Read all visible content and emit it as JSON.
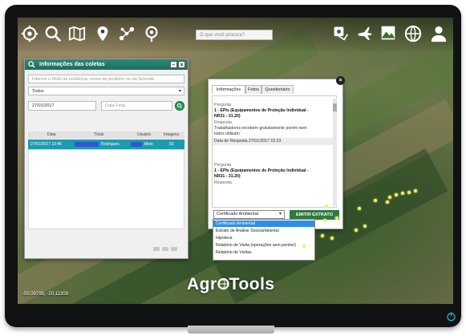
{
  "toolbar": {
    "search_placeholder": "O que você procura?",
    "left_icons": [
      "gear-globe-icon",
      "magnifier-icon",
      "map-icon",
      "map-pin-icon",
      "network-icon",
      "location-target-icon"
    ],
    "right_icons": [
      "gps-route-icon",
      "airplane-icon",
      "landscape-icon",
      "globe-icon",
      "user-icon"
    ]
  },
  "coletas_panel": {
    "title": "Informações das coletas",
    "search_placeholder": "Informe o título da evidência, nome do produtor ou da fazenda",
    "filter_value": "Todos",
    "date_start": "27/01/2017",
    "date_end_placeholder": "Data Final",
    "columns": [
      "Data",
      "Título",
      "Usuário",
      "Imagens"
    ],
    "rows": [
      {
        "data": "27/01/2017 15:46",
        "titulo": "Rodrigues",
        "usuario": "Melo",
        "imagens": "60"
      }
    ]
  },
  "details_panel": {
    "tabs": [
      "Informações",
      "Fotos",
      "Questionário"
    ],
    "active_tab": "Informações",
    "entries": [
      {
        "pergunta_label": "Pergunta",
        "pergunta_lines": [
          "1 - EPIs (Equipamentos de Proteção Individual -",
          "NR31 - 31.20)"
        ],
        "resposta_label": "Resposta",
        "resposta_lines": [
          "Trabalhadores recebem gratuitamente porém nem",
          "todos utilizam"
        ],
        "data_resposta": "Data de Resposta 27/01/2017 15:23"
      },
      {
        "pergunta_label": "Pergunta",
        "pergunta_lines": [
          "1 - EPIs (Equipamentos de Proteção Individual -",
          "NR31 - 31.20)"
        ],
        "resposta_label": "Resposta"
      }
    ],
    "select_value": "Certificado Ambiental",
    "emitir_label": "EMITIR EXTRATO",
    "options": [
      "Certificado Ambiental",
      "Extrato de Análise Socioambiental",
      "Hipoteca",
      "Relatório de Visita (operações sem penhor)",
      "Relatório de Visitas"
    ]
  },
  "logo_text": {
    "part1": "Agr",
    "part2": "Tools"
  },
  "coordinates": "-50.39798, -20.11308",
  "colors": {
    "header_green": "#1f7260",
    "row_teal": "#1e9bb0",
    "emitir_green": "#2f7a3e",
    "dropdown_selected": "#2e8fe8",
    "dot_yellow": "#f2ef5c"
  }
}
